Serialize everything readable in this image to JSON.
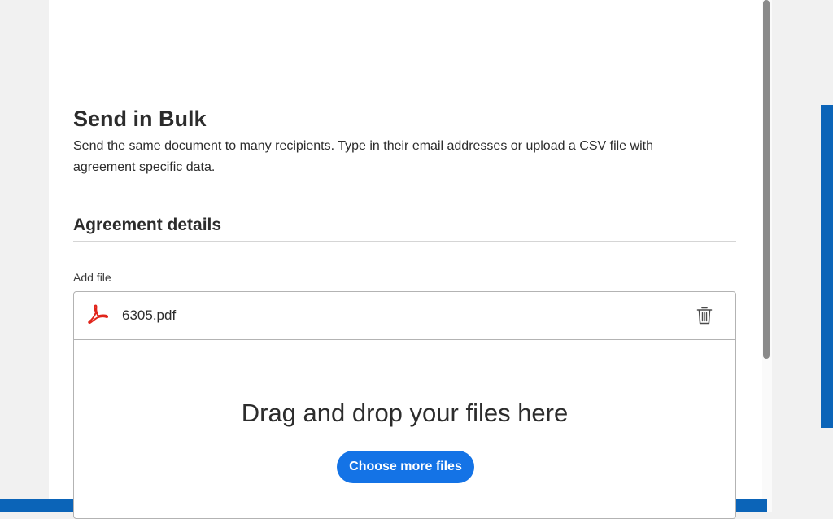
{
  "bulk_send": {
    "title": "Send in Bulk",
    "description": "Send the same document to many recipients. Type in their email addresses or upload a CSV file with agreement specific data."
  },
  "agreement_details": {
    "heading": "Agreement details",
    "add_file_label": "Add file",
    "file": {
      "name": "6305.pdf",
      "icon": "pdf-icon"
    },
    "delete_icon": "trash-icon",
    "drop_zone": {
      "text": "Drag and drop your files here",
      "button_label": "Choose more files"
    }
  },
  "colors": {
    "accent": "#1473e6",
    "pdf_red": "#e1251b",
    "frame_blue": "#0b64b8"
  }
}
